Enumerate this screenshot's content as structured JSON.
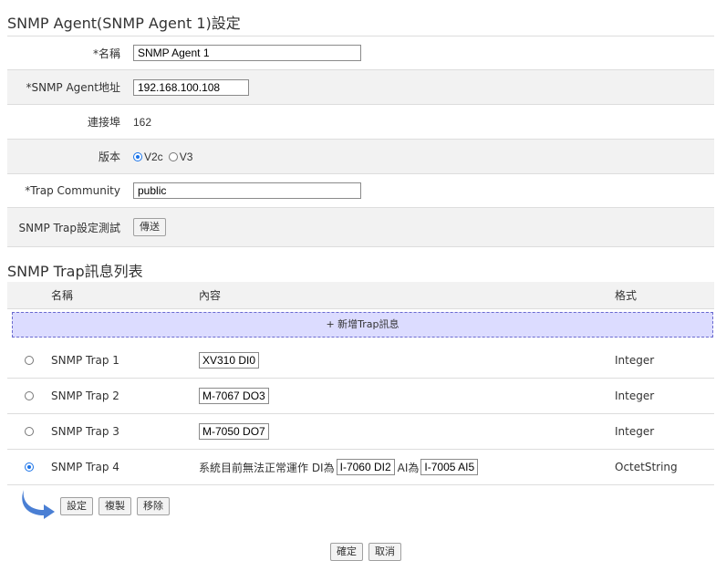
{
  "agent_section": {
    "title": "SNMP Agent(SNMP Agent 1)設定",
    "name_label": "*名稱",
    "name_value": "SNMP Agent 1",
    "address_label": "*SNMP Agent地址",
    "address_value": "192.168.100.108",
    "port_label": "連接埠",
    "port_value": "162",
    "version_label": "版本",
    "version_options": [
      "V2c",
      "V3"
    ],
    "version_selected": "V2c",
    "community_label": "*Trap Community",
    "community_value": "public",
    "test_label": "SNMP Trap設定測試",
    "send_button": "傳送"
  },
  "trap_section": {
    "title": "SNMP Trap訊息列表",
    "columns": [
      "名稱",
      "內容",
      "格式"
    ],
    "add_label": "+ 新增Trap訊息",
    "rows": [
      {
        "name": "SNMP Trap 1",
        "content_tag": "XV310 DI0",
        "format": "Integer",
        "selected": false
      },
      {
        "name": "SNMP Trap 2",
        "content_tag": "M-7067 DO3",
        "format": "Integer",
        "selected": false
      },
      {
        "name": "SNMP Trap 3",
        "content_tag": "M-7050 DO7",
        "format": "Integer",
        "selected": false
      },
      {
        "name": "SNMP Trap 4",
        "content_prefix": "系統目前無法正常運作 DI為",
        "content_tag1": "I-7060 DI2",
        "content_mid": "AI為",
        "content_tag2": "I-7005 AI5",
        "format": "OctetString",
        "selected": true
      }
    ],
    "actions": {
      "set": "設定",
      "copy": "複製",
      "remove": "移除"
    }
  },
  "footer": {
    "ok": "確定",
    "cancel": "取消"
  },
  "colors": {
    "accent": "#1a73e8",
    "add_row_bg": "#dcdcff",
    "arrow": "#4a7fd4"
  }
}
